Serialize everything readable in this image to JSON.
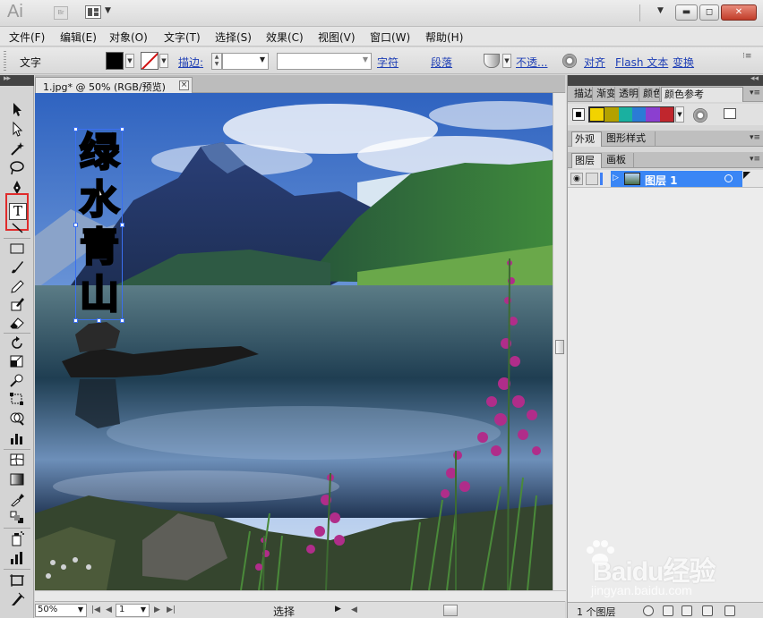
{
  "app": {
    "logo": "Ai",
    "bridge": "Br"
  },
  "window_buttons": {
    "minimize": "▬",
    "restore": "◻",
    "close": "✕"
  },
  "menu": [
    "文件(F)",
    "编辑(E)",
    "对象(O)",
    "文字(T)",
    "选择(S)",
    "效果(C)",
    "视图(V)",
    "窗口(W)",
    "帮助(H)"
  ],
  "control_bar": {
    "context": "文字",
    "stroke_label": "描边:",
    "char_link": "字符",
    "para_link": "段落",
    "opacity_link": "不透...",
    "align_link": "对齐",
    "flash_link": "Flash 文本",
    "transform_link": "变换",
    "font_value": "",
    "stroke_value": "",
    "fill_color": "#000000"
  },
  "document": {
    "tab_label": "1.jpg* @ 50% (RGB/预览)",
    "text_chars": [
      "绿",
      "水",
      "青",
      "山"
    ]
  },
  "status_bar": {
    "zoom": "50%",
    "page": "1",
    "mode": "选择"
  },
  "panels": {
    "top_tabs": [
      "描边",
      "渐变",
      "透明",
      "颜色",
      "颜色参考"
    ],
    "guide_colors": [
      "#f2d300",
      "#b3a100",
      "#1ab0a0",
      "#2b7bd6",
      "#8b3fd0",
      "#c0262d"
    ],
    "mid_tabs": [
      "外观",
      "图形样式"
    ],
    "layer_tabs": [
      "图层",
      "画板"
    ],
    "layer_name": "图层 1",
    "layer_count": "1 个图层"
  },
  "watermark": {
    "brand": "Baidu经验",
    "url": "jingyan.baidu.com"
  }
}
